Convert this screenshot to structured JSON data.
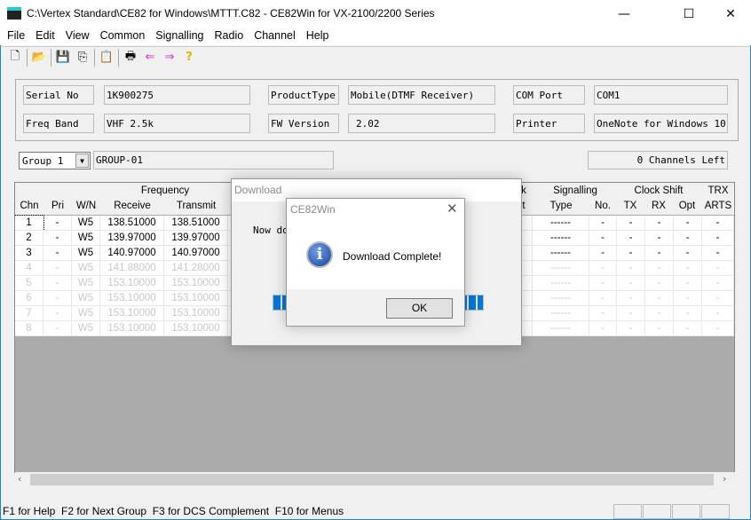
{
  "window": {
    "title": "C:\\Vertex Standard\\CE82 for Windows\\MTTT.C82 - CE82Win for VX-2100/2200 Series",
    "minimize": "—",
    "maximize": "☐",
    "close": "✕"
  },
  "menu": [
    "File",
    "Edit",
    "View",
    "Common",
    "Signalling",
    "Radio",
    "Channel",
    "Help"
  ],
  "toolbar": [
    {
      "icon": "new-icon",
      "glyph": "🗋"
    },
    {
      "icon": "open-icon",
      "glyph": "📂"
    },
    {
      "icon": "save-icon",
      "glyph": "💾"
    },
    {
      "icon": "copy-icon",
      "glyph": "⎘"
    },
    {
      "icon": "paste-icon",
      "glyph": "📋"
    },
    {
      "icon": "print-icon",
      "glyph": "🖶"
    },
    {
      "icon": "upload-icon",
      "glyph": "⇐"
    },
    {
      "icon": "download-icon",
      "glyph": "⇒"
    },
    {
      "icon": "help-icon",
      "glyph": "?"
    }
  ],
  "info": {
    "serial_label": "Serial No",
    "serial": "1K900275",
    "product_label": "ProductType",
    "product": "Mobile(DTMF Receiver)",
    "com_label": "COM Port",
    "com": "COM1",
    "band_label": "Freq Band",
    "band": "VHF 2.5k",
    "fw_label": "FW Version",
    "fw": "2.02",
    "printer_label": "Printer",
    "printer": "OneNote for Windows 10"
  },
  "group": {
    "selected": "Group 1",
    "name": "GROUP-01",
    "channels_left": "0 Channels Left"
  },
  "grid": {
    "headers": {
      "frequency": "Frequency",
      "chn": "Chn",
      "pri": "Pri",
      "wn": "W/N",
      "receive": "Receive",
      "transmit": "Transmit",
      "clipped1": "k",
      "clipped2": "t",
      "signalling": "Signalling",
      "type": "Type",
      "no": "No.",
      "clock_shift": "Clock Shift",
      "tx": "TX",
      "rx": "RX",
      "opt": "Opt",
      "trx": "TRX",
      "arts": "ARTS"
    },
    "rows": [
      {
        "chn": "1",
        "pri": "-",
        "wn": "W5",
        "rx": "138.51000",
        "tx": "138.51000",
        "type": "------",
        "no": "-",
        "cstx": "-",
        "csrx": "-",
        "opt": "-",
        "arts": "-",
        "active": true
      },
      {
        "chn": "2",
        "pri": "-",
        "wn": "W5",
        "rx": "139.97000",
        "tx": "139.97000",
        "type": "------",
        "no": "-",
        "cstx": "-",
        "csrx": "-",
        "opt": "-",
        "arts": "-",
        "active": true
      },
      {
        "chn": "3",
        "pri": "-",
        "wn": "W5",
        "rx": "140.97000",
        "tx": "140.97000",
        "type": "------",
        "no": "-",
        "cstx": "-",
        "csrx": "-",
        "opt": "-",
        "arts": "-",
        "active": true
      },
      {
        "chn": "4",
        "pri": "-",
        "wn": "W5",
        "rx": "141.88000",
        "tx": "141.28000",
        "type": "------",
        "no": "-",
        "cstx": "-",
        "csrx": "-",
        "opt": "-",
        "arts": "-",
        "active": false
      },
      {
        "chn": "5",
        "pri": "-",
        "wn": "W5",
        "rx": "153.10000",
        "tx": "153.10000",
        "type": "------",
        "no": "-",
        "cstx": "-",
        "csrx": "-",
        "opt": "-",
        "arts": "-",
        "active": false
      },
      {
        "chn": "6",
        "pri": "-",
        "wn": "W5",
        "rx": "153.10000",
        "tx": "153.10000",
        "type": "------",
        "no": "-",
        "cstx": "-",
        "csrx": "-",
        "opt": "-",
        "arts": "-",
        "active": false
      },
      {
        "chn": "7",
        "pri": "-",
        "wn": "W5",
        "rx": "153.10000",
        "tx": "153.10000",
        "type": "------",
        "no": "-",
        "cstx": "-",
        "csrx": "-",
        "opt": "-",
        "arts": "-",
        "active": false
      },
      {
        "chn": "8",
        "pri": "-",
        "wn": "W5",
        "rx": "153.10000",
        "tx": "153.10000",
        "type": "------",
        "no": "-",
        "cstx": "-",
        "csrx": "-",
        "opt": "-",
        "arts": "-",
        "active": false
      }
    ]
  },
  "status": {
    "text": "F1 for Help  F2 for Next Group  F3 for DCS Complement  F10 for Menus"
  },
  "download_dialog": {
    "title": "Download",
    "message": "Now do",
    "progress_color": "#0078d7"
  },
  "message_box": {
    "title": "CE82Win",
    "message": "Download Complete!",
    "ok": "OK",
    "icon": "info-icon"
  },
  "colors": {
    "accent": "#1883d7",
    "disabled_text": "#c8c8c8"
  }
}
